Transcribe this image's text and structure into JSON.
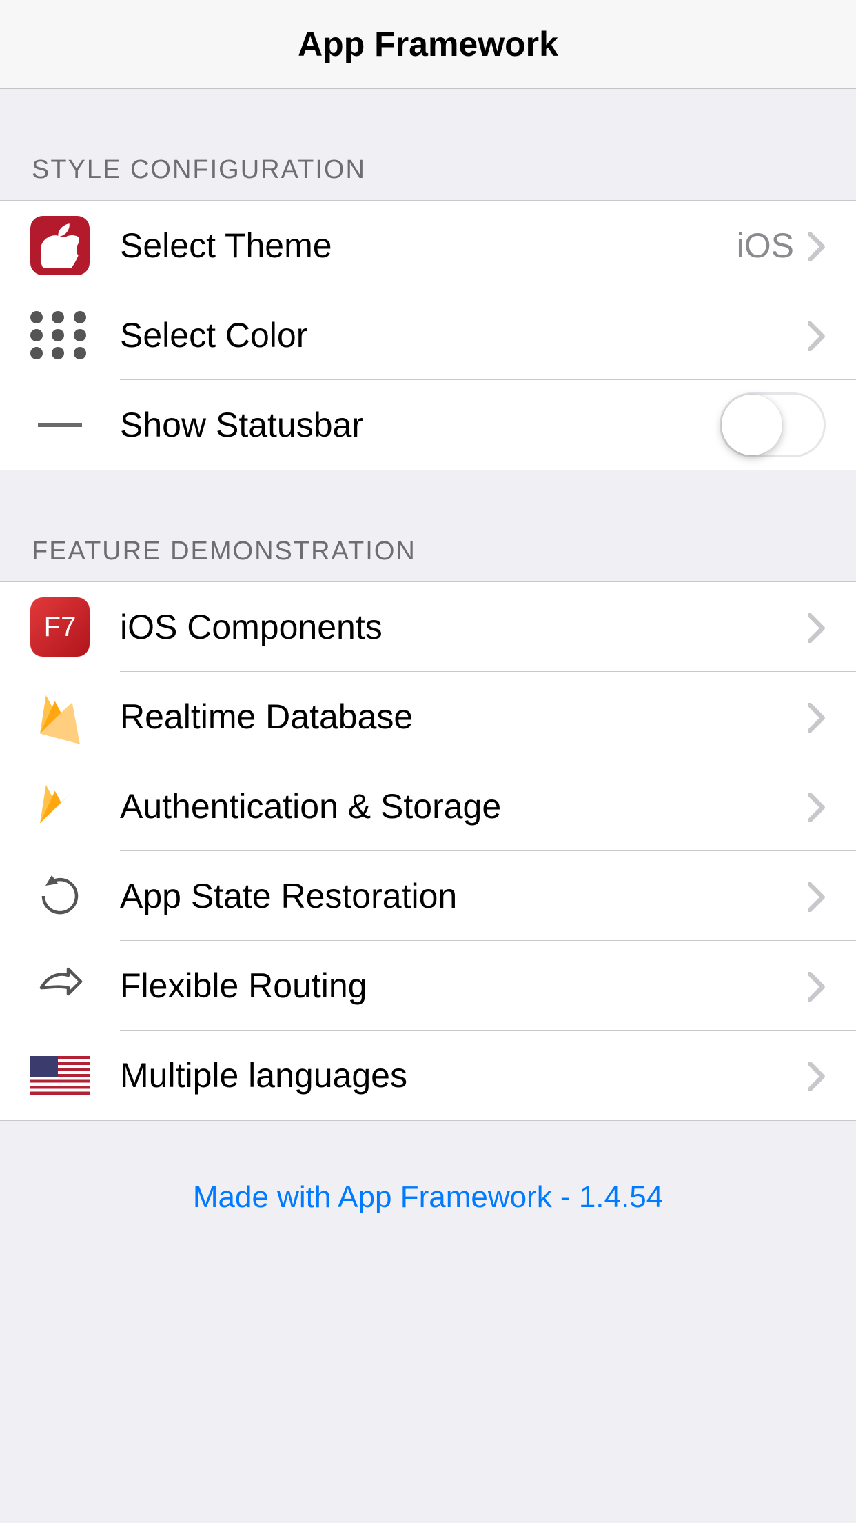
{
  "navbar": {
    "title": "App Framework"
  },
  "sections": {
    "style": {
      "header": "STYLE CONFIGURATION",
      "items": [
        {
          "label": "Select Theme",
          "value": "iOS"
        },
        {
          "label": "Select Color"
        },
        {
          "label": "Show Statusbar",
          "toggle": false
        }
      ]
    },
    "feature": {
      "header": "FEATURE DEMONSTRATION",
      "items": [
        {
          "label": "iOS Components",
          "badge": "F7"
        },
        {
          "label": "Realtime Database"
        },
        {
          "label": "Authentication & Storage"
        },
        {
          "label": "App State Restoration"
        },
        {
          "label": "Flexible Routing"
        },
        {
          "label": "Multiple languages"
        }
      ]
    }
  },
  "footer": {
    "text": "Made with App Framework - 1.4.54"
  }
}
